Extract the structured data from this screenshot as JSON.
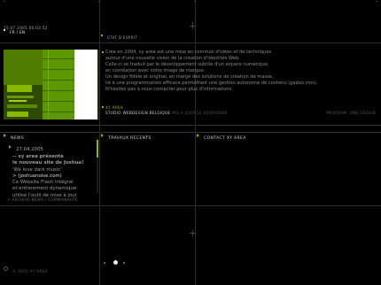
{
  "header": {
    "lang": "FR / EN",
    "datetime": "15.07.2005   00:02:52",
    "state": "ETAT D'ESPRIT :"
  },
  "intro": {
    "lines": [
      "Crée en 2004, xy area est une mise en commun d'idées et de techniques",
      "autour d'une nouvelle vision de la création d'identités Web.",
      "Celle-ci se traduit par le développement subtile d'un espace numérique,",
      "en corrélation avec votre image de marque.",
      "Un design fidèle et original, en marge des solutions de création de masse,",
      "lié à une programmation efficace permettant une gestion autonome de contenu (gadoo.cms).",
      "N'hésitez pas à nous contacter pour plus d'informations."
    ],
    "brand": "XY AREA",
    "tagline": "STUDIO WEBDESIGN BELGIQUE",
    "tagline_rest": "MIS A JOUR LE 00/00/0000",
    "credit": "PROGRAM: ONE DESIGN"
  },
  "nav": {
    "news": "NEWS",
    "works": "TRAVAUX RECENTS",
    "contact": "CONTACT XY AREA"
  },
  "news_item": {
    "date": "27.04.2005",
    "title1": "-- xy area présente",
    "title2": "le nouveau site de Joshua!",
    "quote": "'We love dark music'",
    "link": "> (joshuanoise.com)",
    "body1": "Ce Website Flash intégral",
    "body2": "et entièrement dynamique",
    "body3": "utilise l'outil de mise à jour"
  },
  "footer": {
    "archive": "> ARCHIVE NEWS / COMMUNAUTE",
    "copyright": "© 2005 XY AREA"
  },
  "colors": {
    "accent": "#8ab800",
    "background": "#000000"
  }
}
